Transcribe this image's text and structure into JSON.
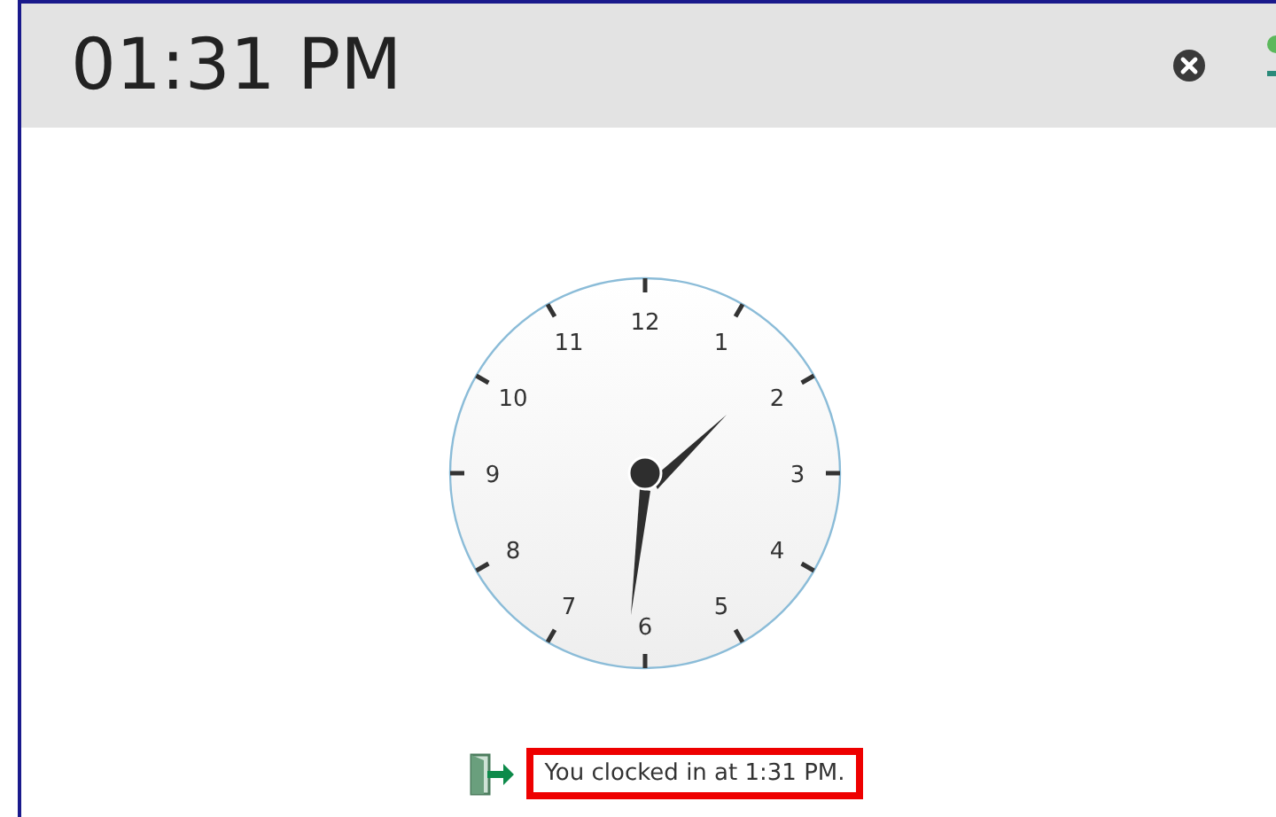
{
  "header": {
    "time": "01:31 PM"
  },
  "clock": {
    "numbers": [
      "12",
      "1",
      "2",
      "3",
      "4",
      "5",
      "6",
      "7",
      "8",
      "9",
      "10",
      "11"
    ]
  },
  "message": "You clocked in at 1:31 PM."
}
